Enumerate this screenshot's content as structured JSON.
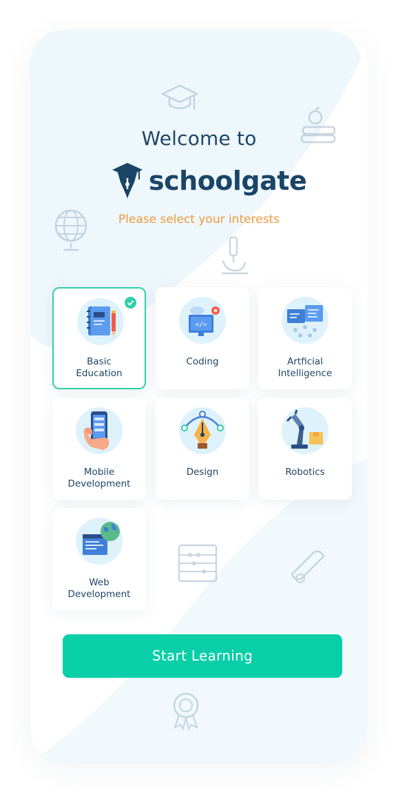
{
  "header": {
    "welcome": "Welcome to",
    "brand_name": "schoolgate",
    "subtitle": "Please select your interests"
  },
  "interests": [
    {
      "label": "Basic\nEducation",
      "icon": "notebook-icon",
      "selected": true
    },
    {
      "label": "Coding",
      "icon": "code-monitor-icon",
      "selected": false
    },
    {
      "label": "Artficial\nIntelligence",
      "icon": "ai-network-icon",
      "selected": false
    },
    {
      "label": "Mobile\nDevelopment",
      "icon": "phone-in-hand-icon",
      "selected": false
    },
    {
      "label": "Design",
      "icon": "pen-tool-icon",
      "selected": false
    },
    {
      "label": "Robotics",
      "icon": "robot-arm-icon",
      "selected": false
    },
    {
      "label": "Web\nDevelopment",
      "icon": "web-globe-icon",
      "selected": false
    }
  ],
  "action": {
    "start_label": "Start Learning"
  },
  "colors": {
    "accent": "#08cfa8",
    "brand": "#1a4567",
    "subtitle": "#f0983a",
    "icon_bg": "#def2fb"
  }
}
